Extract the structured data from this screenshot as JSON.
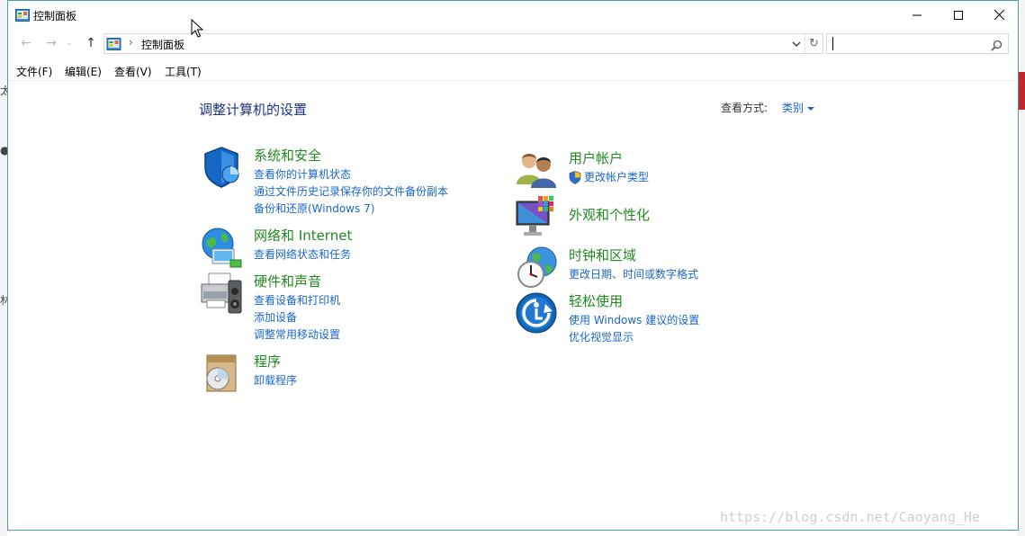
{
  "window": {
    "title": "控制面板"
  },
  "nav": {
    "breadcrumb": "控制面板",
    "search_value": ""
  },
  "menu": {
    "items": [
      "文件(F)",
      "编辑(E)",
      "查看(V)",
      "工具(T)"
    ]
  },
  "main": {
    "heading": "调整计算机的设置",
    "view_by_label": "查看方式:",
    "view_by_value": "类别",
    "categories": [
      {
        "title": "系统和安全",
        "icon": "shield-icon",
        "links": [
          "查看你的计算机状态",
          "通过文件历史记录保存你的文件备份副本",
          "备份和还原(Windows 7)"
        ]
      },
      {
        "title": "网络和 Internet",
        "icon": "globe-network-icon",
        "links": [
          "查看网络状态和任务"
        ]
      },
      {
        "title": "硬件和声音",
        "icon": "printer-speaker-icon",
        "links": [
          "查看设备和打印机",
          "添加设备",
          "调整常用移动设置"
        ]
      },
      {
        "title": "程序",
        "icon": "program-disc-icon",
        "links": [
          "卸载程序"
        ]
      },
      {
        "title": "用户帐户",
        "icon": "users-icon",
        "links": [
          "更改帐户类型"
        ]
      },
      {
        "title": "外观和个性化",
        "icon": "monitor-palette-icon",
        "links": []
      },
      {
        "title": "时钟和区域",
        "icon": "clock-globe-icon",
        "links": [
          "更改日期、时间或数字格式"
        ]
      },
      {
        "title": "轻松使用",
        "icon": "ease-of-access-icon",
        "links": [
          "使用 Windows 建议的设置",
          "优化视觉显示"
        ]
      }
    ]
  },
  "watermark": "https://blog.csdn.net/Caoyang_He",
  "colors": {
    "category_title": "#1e8a1e",
    "link": "#1a66cc",
    "heading": "#1e3287",
    "window_border": "#48a1a7"
  }
}
